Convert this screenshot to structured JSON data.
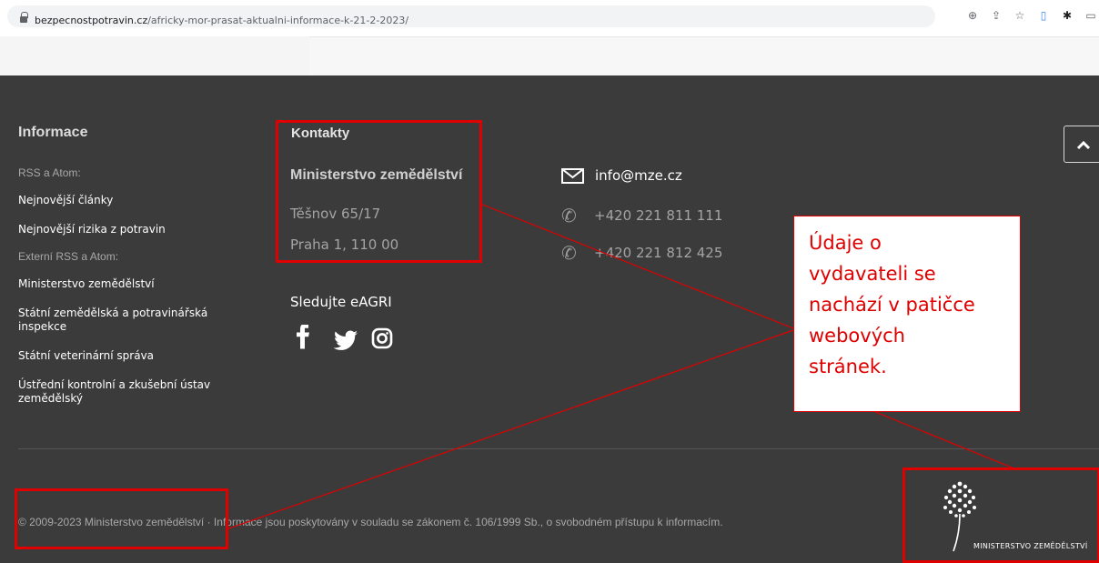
{
  "browser": {
    "url_domain": "bezpecnostpotravin.cz",
    "url_path": "/africky-mor-prasat-aktualni-informace-k-21-2-2023/",
    "toolbar_icons": [
      "zoom-icon",
      "share-icon",
      "star-icon",
      "document-icon",
      "extensions-icon",
      "window-icon"
    ]
  },
  "footer": {
    "info": {
      "title": "Informace",
      "rss_label": "RSS a Atom:",
      "links": [
        "Nejnovější články",
        "Nejnovější rizika z potravin"
      ],
      "external_label": "Externí RSS a Atom:",
      "external_links": [
        "Ministerstvo zemědělství",
        "Státní zemědělská a potravinářská inspekce",
        "Státní veterinární správa",
        "Ústřední kontrolní a zkušební ústav zemědělský"
      ]
    },
    "contacts": {
      "title": "Kontakty",
      "org": "Ministerstvo zemědělství",
      "street": "Těšnov 65/17",
      "city": "Praha 1, 110 00",
      "email": "info@mze.cz",
      "phones": [
        "+420 221 811 111",
        "+420 221 812 425"
      ]
    },
    "social": {
      "title": "Sledujte eAGRI",
      "icons": [
        "facebook-icon",
        "twitter-icon",
        "instagram-icon"
      ]
    },
    "copyright": "© 2009-2023 Ministerstvo zemědělství · Informace jsou poskytovány v souladu se zákonem č. 106/1999 Sb., o svobodném přístupu k informacím.",
    "logo_text": "MINISTERSTVO ZEMĚDĚLSTVÍ"
  },
  "annotation": {
    "callout_lines": [
      "Údaje o",
      "vydavateli se",
      "nachází v patičce",
      "webových",
      "stránek."
    ],
    "color": "#e00000"
  },
  "colors": {
    "footer_bg": "#3b3b3b",
    "accent_red": "#e00000"
  }
}
